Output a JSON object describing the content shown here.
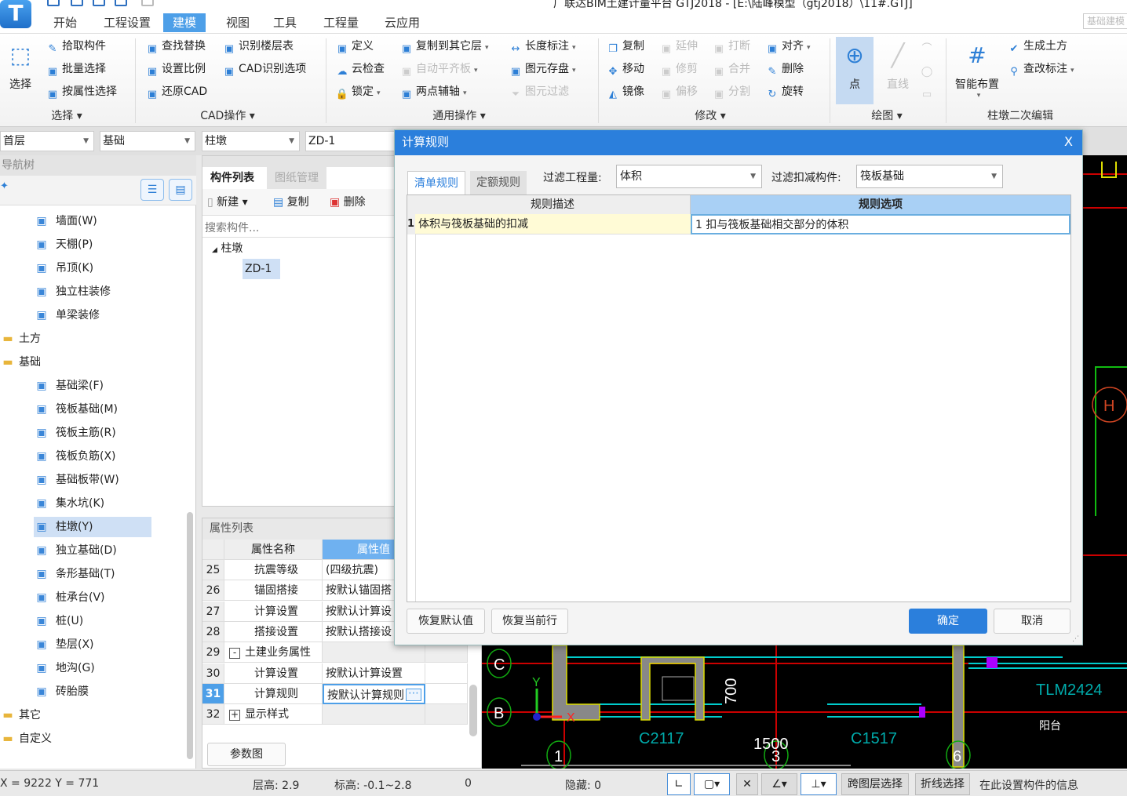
{
  "app": {
    "logo_letter": "T",
    "title": "广联达BIM土建计量平台 GTJ2018 - [E:\\陆峰模型（gtj2018）\\11#.GTJ]",
    "mode_box": "基础建模",
    "menu_tabs": [
      {
        "label": "开始"
      },
      {
        "label": "工程设置"
      },
      {
        "label": "建模",
        "active": true
      },
      {
        "label": "视图"
      },
      {
        "label": "工具"
      },
      {
        "label": "工程量"
      },
      {
        "label": "云应用"
      }
    ]
  },
  "ribbon": {
    "groups": [
      {
        "label": "选择 ▾",
        "big": [
          {
            "label": "选择",
            "icon": "select-arrow-icon"
          }
        ],
        "columns": [
          [
            {
              "label": "拾取构件",
              "icon": "eyedropper-icon"
            },
            {
              "label": "批量选择",
              "icon": "batch-select-icon"
            },
            {
              "label": "按属性选择",
              "icon": "property-select-icon"
            }
          ]
        ]
      },
      {
        "label": "CAD操作 ▾",
        "big": [],
        "columns": [
          [
            {
              "label": "查找替换",
              "icon": "find-replace-icon"
            },
            {
              "label": "设置比例",
              "icon": "scale-icon"
            },
            {
              "label": "还原CAD",
              "icon": "restore-cad-icon"
            }
          ],
          [
            {
              "label": "识别楼层表",
              "icon": "floor-table-icon"
            },
            {
              "label": "CAD识别选项",
              "icon": "cad-options-icon"
            }
          ]
        ]
      },
      {
        "label": "通用操作 ▾",
        "big": [],
        "columns": [
          [
            {
              "label": "定义",
              "icon": "define-icon"
            },
            {
              "label": "云检查",
              "icon": "cloud-check-icon"
            },
            {
              "label": "锁定",
              "icon": "lock-icon",
              "dropdown": true
            }
          ],
          [
            {
              "label": "复制到其它层",
              "icon": "copy-layer-icon",
              "dropdown": true
            },
            {
              "label": "自动平齐板",
              "icon": "align-slab-icon",
              "dropdown": true,
              "disabled": true
            },
            {
              "label": "两点辅轴",
              "icon": "aux-axis-icon",
              "dropdown": true
            }
          ],
          [
            {
              "label": "长度标注",
              "icon": "length-dim-icon",
              "dropdown": true
            },
            {
              "label": "图元存盘",
              "icon": "save-element-icon",
              "dropdown": true
            },
            {
              "label": "图元过滤",
              "icon": "filter-icon",
              "disabled": true
            }
          ]
        ]
      },
      {
        "label": "修改 ▾",
        "big": [],
        "columns": [
          [
            {
              "label": "复制",
              "icon": "copy-icon"
            },
            {
              "label": "移动",
              "icon": "move-icon"
            },
            {
              "label": "镜像",
              "icon": "mirror-icon"
            }
          ],
          [
            {
              "label": "延伸",
              "icon": "extend-icon",
              "disabled": true
            },
            {
              "label": "修剪",
              "icon": "trim-icon",
              "disabled": true
            },
            {
              "label": "偏移",
              "icon": "offset-icon",
              "disabled": true
            }
          ],
          [
            {
              "label": "打断",
              "icon": "break-icon",
              "disabled": true
            },
            {
              "label": "合并",
              "icon": "merge-icon",
              "disabled": true
            },
            {
              "label": "分割",
              "icon": "split-icon",
              "disabled": true
            }
          ],
          [
            {
              "label": "对齐",
              "icon": "align-icon",
              "dropdown": true
            },
            {
              "label": "删除",
              "icon": "delete-brush-icon"
            },
            {
              "label": "旋转",
              "icon": "rotate-icon"
            }
          ]
        ]
      },
      {
        "label": "绘图 ▾",
        "big": [
          {
            "label": "点",
            "icon": "point-icon",
            "active": true
          },
          {
            "label": "直线",
            "icon": "line-icon",
            "disabled": true
          }
        ],
        "columns": [
          [
            {
              "label": "",
              "icon": "arc-icon",
              "disabled": true
            },
            {
              "label": "",
              "icon": "circle-icon",
              "disabled": true
            },
            {
              "label": "",
              "icon": "rectangle-icon",
              "disabled": true
            }
          ]
        ]
      },
      {
        "label": "柱墩二次编辑",
        "big": [
          {
            "label": "智能布置",
            "icon": "smart-layout-icon",
            "dropdown": true
          }
        ],
        "columns": [
          [
            {
              "label": "生成土方",
              "icon": "generate-earthwork-icon"
            },
            {
              "label": "查改标注",
              "icon": "edit-annotation-icon",
              "dropdown": true
            }
          ]
        ]
      }
    ]
  },
  "selectors": [
    {
      "value": "首层"
    },
    {
      "value": "基础"
    },
    {
      "value": "柱墩"
    },
    {
      "value": "ZD-1"
    }
  ],
  "nav": {
    "header": "导航树",
    "items": [
      {
        "label": "墙面(W)",
        "level": 2,
        "icon": "wall-surface-icon"
      },
      {
        "label": "天棚(P)",
        "level": 2,
        "icon": "ceiling-icon"
      },
      {
        "label": "吊顶(K)",
        "level": 2,
        "icon": "suspended-ceiling-icon"
      },
      {
        "label": "独立柱装修",
        "level": 2,
        "icon": "column-finish-icon"
      },
      {
        "label": "单梁装修",
        "level": 2,
        "icon": "beam-finish-icon"
      },
      {
        "label": "土方",
        "level": 1,
        "icon": "folder-plus-icon"
      },
      {
        "label": "基础",
        "level": 1,
        "icon": "folder-minus-icon"
      },
      {
        "label": "基础梁(F)",
        "level": 2,
        "icon": "foundation-beam-icon"
      },
      {
        "label": "筏板基础(M)",
        "level": 2,
        "icon": "raft-foundation-icon"
      },
      {
        "label": "筏板主筋(R)",
        "level": 2,
        "icon": "raft-main-rebar-icon"
      },
      {
        "label": "筏板负筋(X)",
        "level": 2,
        "icon": "raft-neg-rebar-icon"
      },
      {
        "label": "基础板带(W)",
        "level": 2,
        "icon": "slab-strip-icon"
      },
      {
        "label": "集水坑(K)",
        "level": 2,
        "icon": "sump-icon"
      },
      {
        "label": "柱墩(Y)",
        "level": 2,
        "icon": "column-pier-icon",
        "selected": true
      },
      {
        "label": "独立基础(D)",
        "level": 2,
        "icon": "isolated-foundation-icon"
      },
      {
        "label": "条形基础(T)",
        "level": 2,
        "icon": "strip-foundation-icon"
      },
      {
        "label": "桩承台(V)",
        "level": 2,
        "icon": "pile-cap-icon"
      },
      {
        "label": "桩(U)",
        "level": 2,
        "icon": "pile-icon"
      },
      {
        "label": "垫层(X)",
        "level": 2,
        "icon": "cushion-icon"
      },
      {
        "label": "地沟(G)",
        "level": 2,
        "icon": "trench-icon"
      },
      {
        "label": "砖胎膜",
        "level": 2,
        "icon": "brick-mold-icon"
      },
      {
        "label": "其它",
        "level": 1,
        "icon": "folder-plus-icon"
      },
      {
        "label": "自定义",
        "level": 1,
        "icon": "folder-plus-icon"
      }
    ]
  },
  "components": {
    "tabs": [
      {
        "label": "构件列表",
        "active": true
      },
      {
        "label": "图纸管理"
      }
    ],
    "toolbar": [
      {
        "label": "新建 ▾",
        "icon": "new-icon"
      },
      {
        "label": "复制",
        "icon": "copy-icon"
      },
      {
        "label": "删除",
        "icon": "delete-icon"
      }
    ],
    "search_placeholder": "搜索构件...",
    "tree_root": "柱墩",
    "tree_child": "ZD-1"
  },
  "properties": {
    "title": "属性列表",
    "col_name": "属性名称",
    "col_value": "属性值",
    "rows": [
      {
        "num": "25",
        "name": "抗震等级",
        "value": "(四级抗震)",
        "indent": 2
      },
      {
        "num": "26",
        "name": "锚固搭接",
        "value": "按默认锚固搭",
        "indent": 2
      },
      {
        "num": "27",
        "name": "计算设置",
        "value": "按默认计算设",
        "indent": 2
      },
      {
        "num": "28",
        "name": "搭接设置",
        "value": "按默认搭接设",
        "indent": 2
      },
      {
        "num": "29",
        "name": "土建业务属性",
        "value": "",
        "indent": 1,
        "toggle": "-"
      },
      {
        "num": "30",
        "name": "计算设置",
        "value": "按默认计算设置",
        "indent": 2
      },
      {
        "num": "31",
        "name": "计算规则",
        "value": "按默认计算规则",
        "indent": 2,
        "selected": true
      },
      {
        "num": "32",
        "name": "显示样式",
        "value": "",
        "indent": 1,
        "toggle": "+"
      }
    ],
    "param_button": "参数图"
  },
  "dialog": {
    "title": "计算规则",
    "close": "X",
    "tabs": [
      {
        "label": "清单规则",
        "active": true
      },
      {
        "label": "定额规则"
      }
    ],
    "filter_quantity_label": "过滤工程量:",
    "filter_quantity_value": "体积",
    "filter_component_label": "过滤扣减构件:",
    "filter_component_value": "筏板基础",
    "columns": [
      "规则描述",
      "规则选项"
    ],
    "rows": [
      {
        "num": "1",
        "desc": "体积与筏板基础的扣减",
        "option": "1 扣与筏板基础相交部分的体积"
      }
    ],
    "buttons": {
      "restore_default": "恢复默认值",
      "restore_row": "恢复当前行",
      "ok": "确定",
      "cancel": "取消"
    }
  },
  "canvas": {
    "labels": [
      "C",
      "B",
      "1",
      "3",
      "6",
      "H",
      "C2117",
      "C1517",
      "TLM2424",
      "阳台",
      "1500",
      "700",
      "X",
      "Y"
    ]
  },
  "status": {
    "coords": "X = 9222 Y = 771",
    "floor_height": "层高:  2.9",
    "elevation": "标高:  -0.1~2.8",
    "zero": "0",
    "hidden": "隐藏:  0",
    "cross_layer": "跨图层选择",
    "polyline_select": "折线选择",
    "hint": "在此设置构件的信息"
  },
  "colors": {
    "accent": "#2b7fdc",
    "tab_active": "#4d9fe8",
    "selected_row": "#cfe0f5",
    "rule_desc_bg": "#fffbd6",
    "canvas_bg": "#000000"
  }
}
